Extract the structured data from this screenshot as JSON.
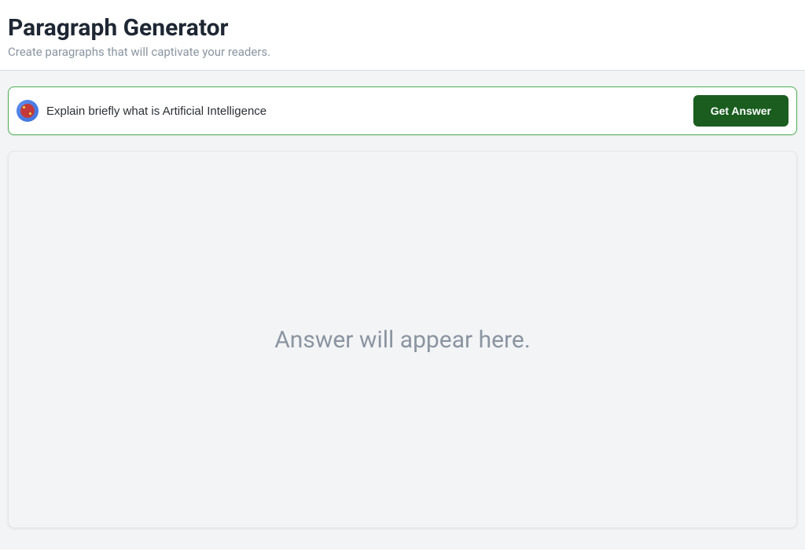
{
  "header": {
    "title": "Paragraph Generator",
    "subtitle": "Create paragraphs that will captivate your readers."
  },
  "input": {
    "value": "Explain briefly what is Artificial Intelligence",
    "icon_name": "virus-icon"
  },
  "actions": {
    "get_answer_label": "Get Answer"
  },
  "answer": {
    "placeholder": "Answer will appear here."
  }
}
